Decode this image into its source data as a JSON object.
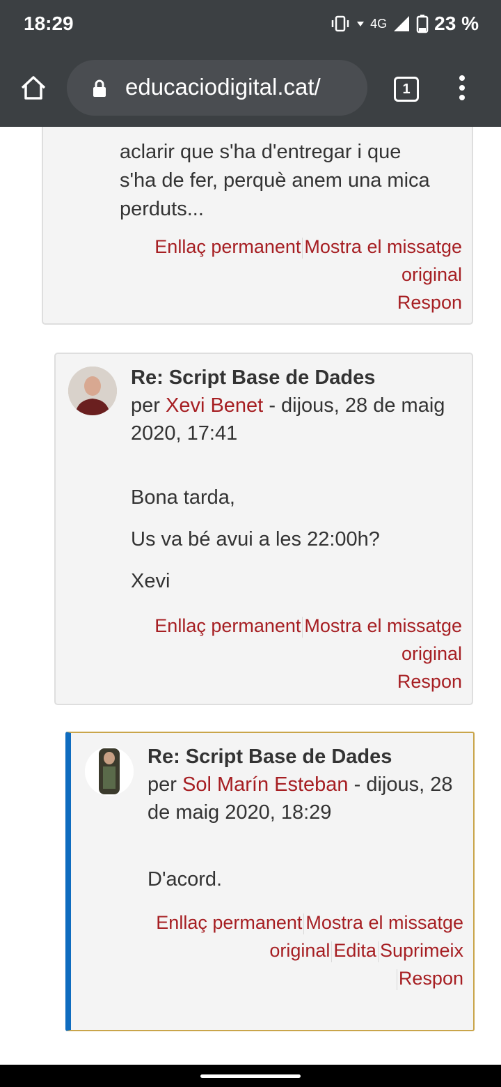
{
  "status_bar": {
    "time": "18:29",
    "network": "4G",
    "battery": "23 %"
  },
  "browser": {
    "url": "educaciodigital.cat/",
    "tab_count": "1"
  },
  "posts": [
    {
      "body_lines": [
        "aclarir que s'ha d'entregar i que",
        "s'ha de fer, perquè anem una mica",
        "perduts..."
      ],
      "actions": [
        "Enllaç permanent",
        "Mostra el missatge original",
        "Respon"
      ]
    },
    {
      "subject": "Re: Script Base de Dades",
      "by_prefix": "per",
      "author": "Xevi Benet",
      "date": "- dijous, 28 de maig 2020, 17:41",
      "paragraphs": [
        "Bona tarda,",
        "Us va bé avui a les 22:00h?",
        "Xevi"
      ],
      "actions": [
        "Enllaç permanent",
        "Mostra el missatge original",
        "Respon"
      ]
    },
    {
      "subject": "Re: Script Base de Dades",
      "by_prefix": "per",
      "author": "Sol Marín Esteban",
      "date": "- dijous, 28 de maig 2020, 18:29",
      "paragraphs": [
        "D'acord."
      ],
      "actions": [
        "Enllaç permanent",
        "Mostra el missatge original",
        "Edita",
        "Suprimeix",
        "Respon"
      ]
    }
  ],
  "colors": {
    "link": "#a61e22",
    "highlight_border": "#0f6cbf",
    "chrome_bg": "#3c4043"
  }
}
